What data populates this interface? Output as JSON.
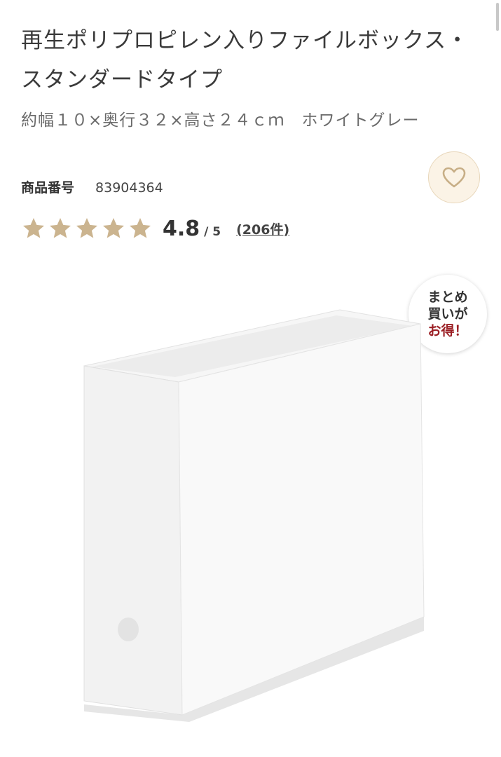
{
  "product": {
    "title": "再生ポリプロピレン入りファイルボックス・スタンダードタイプ",
    "spec": "約幅１０×奥行３２×高さ２４ｃｍ　ホワイトグレー",
    "number_label": "商品番号",
    "number_value": "83904364"
  },
  "rating": {
    "stars_filled": 5,
    "score": "4.8",
    "out_of": "/ 5",
    "reviews": "(206件)"
  },
  "badge": {
    "line1": "まとめ",
    "line2": "買いが",
    "line3": "お得！"
  },
  "icons": {
    "favorite": "heart-icon",
    "star": "star-icon"
  },
  "colors": {
    "star": "#cbb48f",
    "accent_red": "#9b1f24",
    "fav_bg": "#fbf3e6"
  }
}
